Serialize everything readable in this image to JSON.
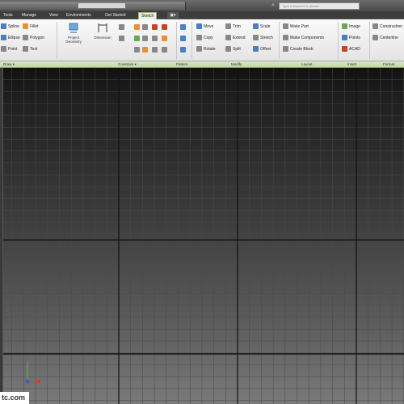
{
  "search": {
    "placeholder": "Type a keyword or phrase"
  },
  "tabs": [
    {
      "label": "Tools"
    },
    {
      "label": "Manage"
    },
    {
      "label": "View"
    },
    {
      "label": "Environments"
    },
    {
      "label": "Get Started"
    },
    {
      "label": "Sketch",
      "active": true
    }
  ],
  "ribbon": {
    "draw": {
      "spline": "Spline",
      "fillet": "Fillet",
      "ellipse": "Ellipse",
      "polygon": "Polygon",
      "point": "Point",
      "text": "Text"
    },
    "constrain": {
      "project_geometry": "Project Geometry",
      "dimension": "Dimension"
    },
    "modify": {
      "move": "Move",
      "trim": "Trim",
      "scale": "Scale",
      "copy": "Copy",
      "extend": "Extend",
      "stretch": "Stretch",
      "rotate": "Rotate",
      "split": "Split",
      "offset": "Offset"
    },
    "layout": {
      "make_part": "Make Part",
      "make_components": "Make Components",
      "create_block": "Create Block"
    },
    "insert": {
      "image": "Image",
      "points": "Points",
      "acad": "ACAD"
    },
    "format": {
      "construction": "Construction",
      "centerline": "Centerline"
    }
  },
  "panels": {
    "draw": "Draw",
    "constrain": "Constrain",
    "pattern": "Pattern",
    "modify": "Modify",
    "layout": "Layout",
    "insert": "Insert",
    "format": "Format"
  },
  "watermark": "tc.com",
  "colors": {
    "ribbon_panelbar": "#c9ddb1",
    "canvas_dark": "#111111",
    "canvas_light": "#7a7a7a",
    "grid_major": "#111111",
    "grid_minor": "#4a4a4a"
  }
}
